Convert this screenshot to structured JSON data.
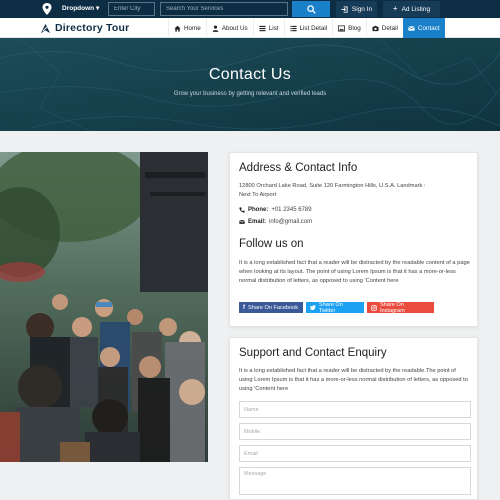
{
  "topbar": {
    "dropdown_label": "Dropdown",
    "city_placeholder": "Enter City",
    "search_placeholder": "Search Your Services",
    "signin_label": "Sign In",
    "ad_listing_label": "Ad Listing"
  },
  "navbar": {
    "brand": "Directory Tour",
    "items": [
      {
        "label": "Home",
        "icon": "home-icon"
      },
      {
        "label": "About Us",
        "icon": "user-icon"
      },
      {
        "label": "List",
        "icon": "list-icon"
      },
      {
        "label": "List Detail",
        "icon": "list-detail-icon"
      },
      {
        "label": "Blog",
        "icon": "image-icon"
      },
      {
        "label": "Detail",
        "icon": "camera-icon"
      },
      {
        "label": "Contact",
        "icon": "envelope-icon",
        "active": true
      }
    ]
  },
  "hero": {
    "title": "Contact Us",
    "subtitle": "Grow your business by getting relevant and verified leads"
  },
  "address_card": {
    "title": "Address & Contact Info",
    "address_line1": "12800 Orchard Lake Road, Suite 120 Farmington Hills, U.S.A. Landmark :",
    "address_line2": "Next To Airport",
    "phone_label": "Phone:",
    "phone_value": "+01 2345 6789",
    "email_label": "Email:",
    "email_value": "info@gmail.com",
    "follow_title": "Follow us on",
    "follow_text": "It is a long established fact that a reader will be distracted by the readable content of a page when looking at its layout. The point of using Lorem Ipsum is that it has a more-or-less normal distribution of letters, as opposed to using 'Content here",
    "facebook_label": "Share On Facebook",
    "twitter_label": "Share On Twitter",
    "instagram_label": "Share On Instagram"
  },
  "enquiry_card": {
    "title": "Support and Contact Enquiry",
    "text": "It is a long established fact that a reader will be distracted by the readable.The point of using Lorem Ipsum is that it has a more-or-less normal distribution of letters, as opposed to using 'Content here",
    "name_placeholder": "Name",
    "mobile_placeholder": "Mobile",
    "email_placeholder": "Email",
    "message_placeholder": "Message"
  },
  "colors": {
    "topbar_bg": "#0d2d44",
    "accent": "#1a80c9",
    "facebook": "#3b5998",
    "twitter": "#1da1f2",
    "instagram": "#e94b3c"
  }
}
